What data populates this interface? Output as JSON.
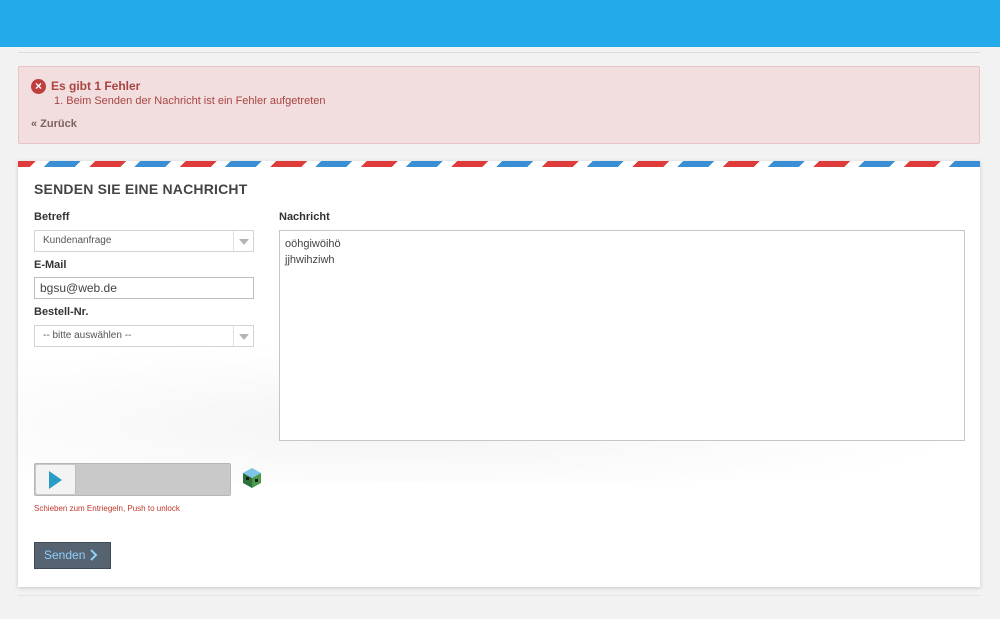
{
  "alert": {
    "title": "Es gibt 1 Fehler",
    "message": "1. Beim Senden der Nachricht ist ein Fehler aufgetreten",
    "back_link": "« Zurück"
  },
  "form": {
    "heading": "SENDEN SIE EINE NACHRICHT",
    "subject": {
      "label": "Betreff",
      "selected": "Kundenanfrage"
    },
    "email": {
      "label": "E-Mail",
      "value": "bgsu@web.de"
    },
    "order": {
      "label": "Bestell-Nr.",
      "selected": "-- bitte auswählen --"
    },
    "message": {
      "label": "Nachricht",
      "lines": [
        "oöhgiwöihö",
        "jjhwihziwh"
      ]
    },
    "slider_hint": "Schieben zum Entriegeln, Push to unlock",
    "submit_label": "Senden"
  },
  "colors": {
    "topbar": "#22aaea",
    "alert_bg": "#f2dedf",
    "alert_text": "#a94442",
    "button_bg": "#566370",
    "button_text": "#8fd0ff",
    "slider_arrow": "#2a9bc7"
  },
  "icons": {
    "alert": "error-circle-icon",
    "slider": "arrow-right-icon",
    "lock": "cube-lock-icon",
    "submit": "chevron-right-icon"
  }
}
